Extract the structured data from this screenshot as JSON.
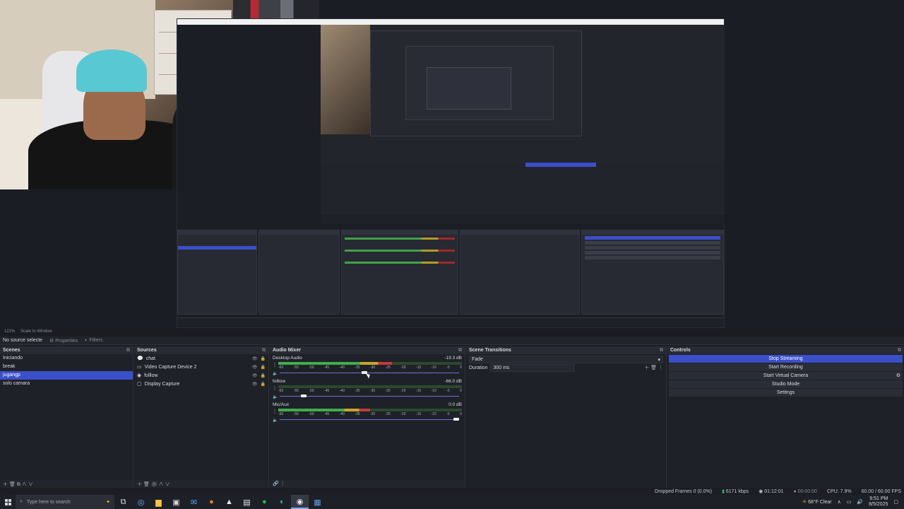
{
  "zoom": {
    "percent": "121%",
    "mode": "Scale to Window"
  },
  "source_bar": {
    "selected": "No source selecte",
    "properties": "Properties",
    "filters": "Filters"
  },
  "scenes": {
    "title": "Scenes",
    "items": [
      "Iniciando",
      "break",
      "jugangp",
      "solo camara"
    ],
    "selected_index": 2
  },
  "sources": {
    "title": "Sources",
    "items": [
      {
        "name": "chat",
        "icon": "chat-icon"
      },
      {
        "name": "Video Capture Device 2",
        "icon": "camera-icon"
      },
      {
        "name": "folllow",
        "icon": "globe-icon"
      },
      {
        "name": "Display Capture",
        "icon": "monitor-icon"
      }
    ]
  },
  "mixer": {
    "title": "Audio Mixer",
    "channels": [
      {
        "name": "Desktop Audio",
        "db": "-19.3 dB",
        "level": 0.62,
        "fader": 0.47
      },
      {
        "name": "folllow",
        "db": "-66.0 dB",
        "level": 0.0,
        "fader": 0.12
      },
      {
        "name": "Mic/Aux",
        "db": "0.0 dB",
        "level": 0.5,
        "fader": 1.0
      }
    ],
    "ticks": [
      "-60",
      "-55",
      "-50",
      "-45",
      "-40",
      "-35",
      "-30",
      "-25",
      "-20",
      "-15",
      "-10",
      "-5",
      "0"
    ]
  },
  "transitions": {
    "title": "Scene Transitions",
    "type": "Fade",
    "duration_label": "Duration",
    "duration_value": "300 ms"
  },
  "controls": {
    "title": "Controls",
    "buttons": [
      "Stop Streaming",
      "Start Recording",
      "Start Virtual Camera",
      "Studio Mode",
      "Settings"
    ]
  },
  "status": {
    "dropped": "Dropped Frames 0 (0.0%)",
    "bitrate": "6171 kbps",
    "stream_time": "01:12:01",
    "rec_time": "00:00:00",
    "cpu": "CPU: 7.9%",
    "fps": "60.00 / 60.00 FPS"
  },
  "taskbar": {
    "search_placeholder": "Type here to search",
    "weather": "68°F  Clear",
    "time": "9:51 PM",
    "date": "8/5/2025"
  },
  "colors": {
    "accent": "#3b4fc9",
    "meter_green": "#3fae49",
    "meter_yellow": "#c8a628",
    "meter_red": "#c23a3a"
  }
}
